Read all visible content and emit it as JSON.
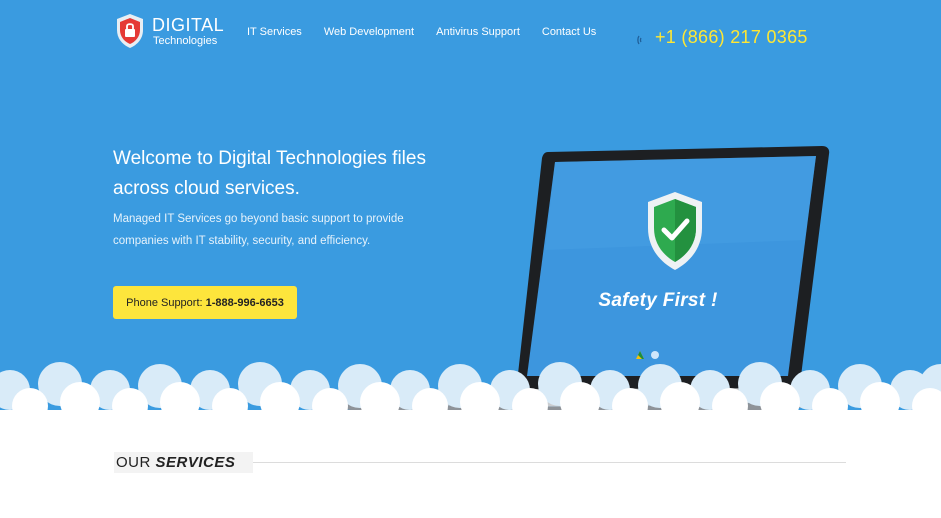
{
  "brand": {
    "name_top": "DIGITAL",
    "name_bottom": "Technologies"
  },
  "nav": [
    {
      "label": "IT Services"
    },
    {
      "label": "Web Development"
    },
    {
      "label": "Antivirus Support"
    },
    {
      "label": "Contact Us"
    }
  ],
  "header": {
    "phone": "+1 (866) 217 0365"
  },
  "hero": {
    "headline": "Welcome to Digital Technologies files across cloud services.",
    "subtext": "Managed IT Services go beyond basic support to provide companies with IT stability, security, and efficiency.",
    "cta_prefix": "Phone Support:",
    "cta_number": "1-888-996-6653",
    "screen_text": "Safety First !"
  },
  "services": {
    "title_plain": "OUR",
    "title_bold": "SERVICES"
  },
  "colors": {
    "hero_bg": "#3a9be0",
    "accent_yellow": "#fde53c",
    "phone_yellow": "#ffe733",
    "shield_green": "#2eaa4f",
    "logo_red": "#e53935"
  }
}
